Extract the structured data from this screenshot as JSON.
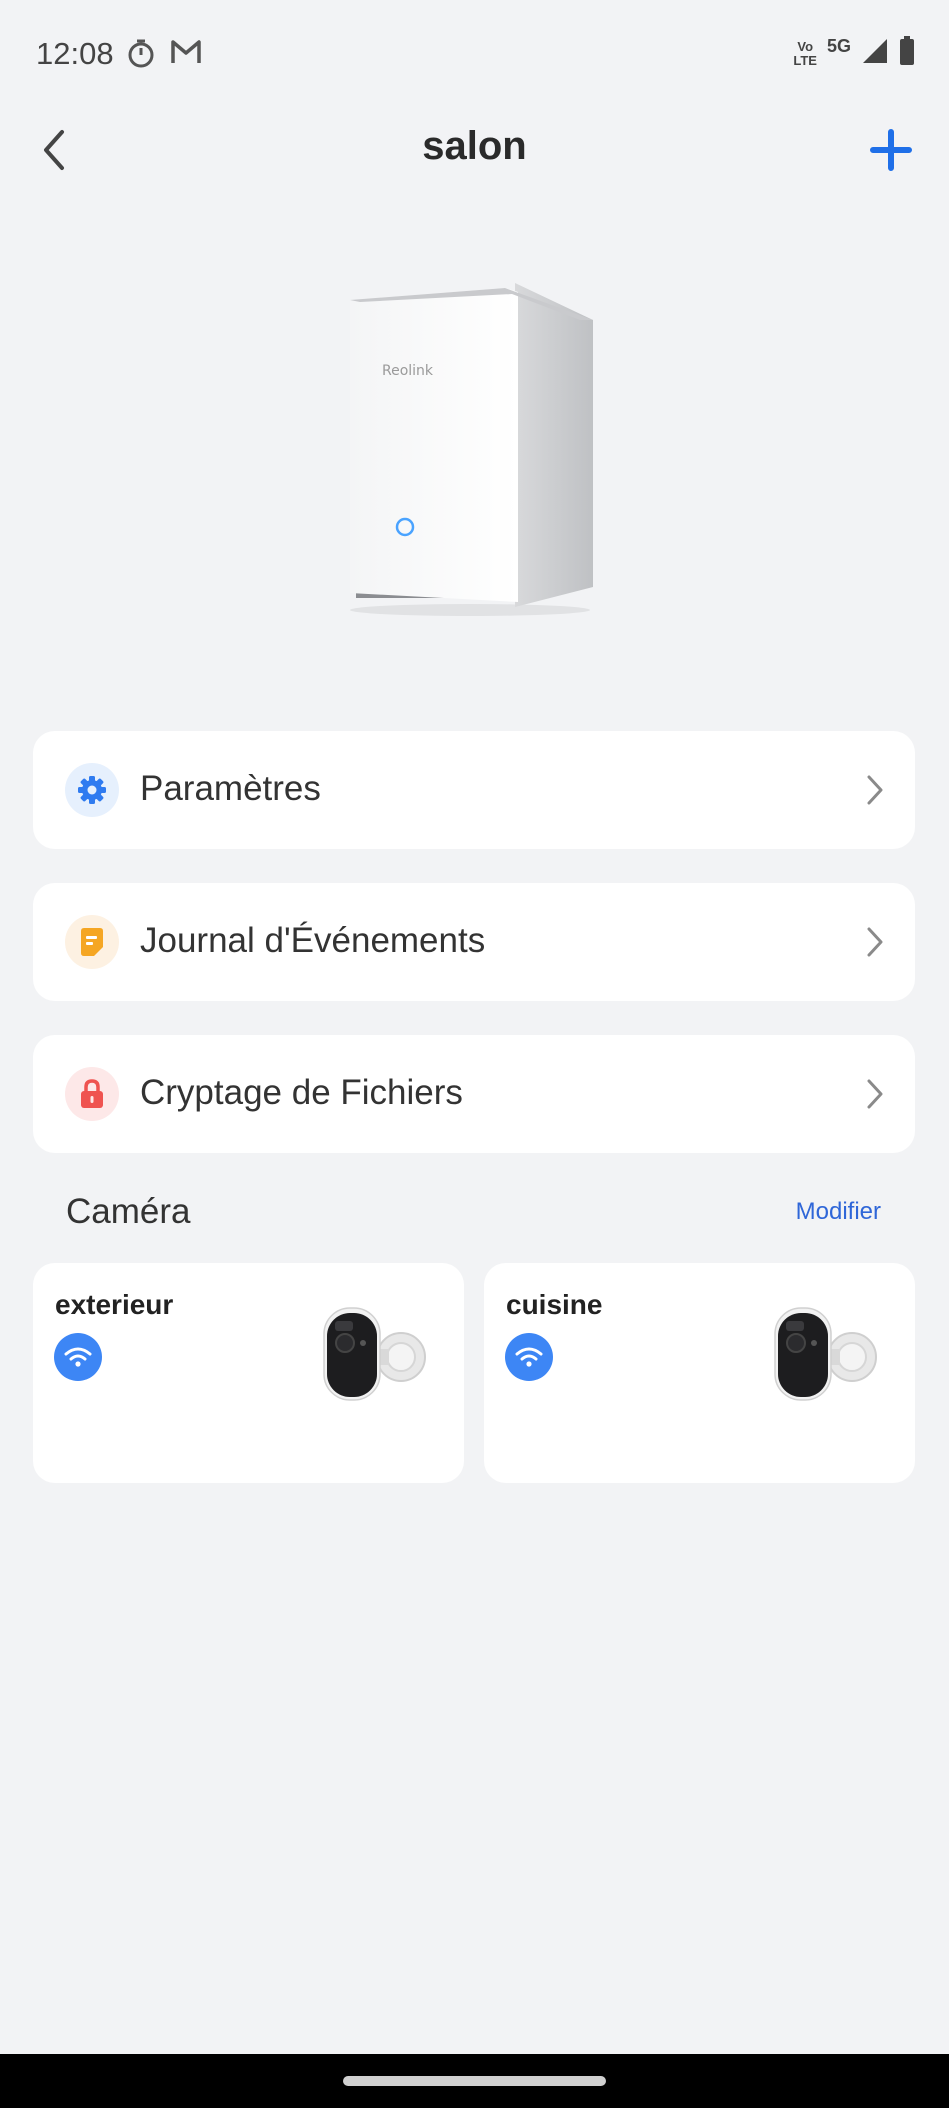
{
  "status_bar": {
    "time": "12:08",
    "volte_top": "Vo",
    "volte_bottom": "LTE",
    "network": "5G",
    "icons": [
      "timer-icon",
      "gmail-icon",
      "volte-icon",
      "signal-icon",
      "battery-icon"
    ]
  },
  "header": {
    "title": "salon",
    "back_icon": "back-chevron-icon",
    "add_icon": "plus-icon"
  },
  "device": {
    "brand": "Reolink"
  },
  "menu": [
    {
      "label": "Paramètres",
      "icon": "gear-icon",
      "icon_color": "#2f7bf0",
      "icon_bg": "#e6f0fd"
    },
    {
      "label": "Journal d'Événements",
      "icon": "note-icon",
      "icon_color": "#f5a623",
      "icon_bg": "#fdf1e2"
    },
    {
      "label": "Cryptage de Fichiers",
      "icon": "lock-icon",
      "icon_color": "#ef5350",
      "icon_bg": "#fde8e8"
    }
  ],
  "camera_section": {
    "title": "Caméra",
    "action": "Modifier"
  },
  "cameras": [
    {
      "name": "exterieur",
      "status_icon": "wifi-icon"
    },
    {
      "name": "cuisine",
      "status_icon": "wifi-icon"
    }
  ],
  "colors": {
    "accent": "#1f6fe8",
    "background": "#f2f3f5",
    "card": "#ffffff",
    "wifi_badge": "#3d86f5"
  }
}
